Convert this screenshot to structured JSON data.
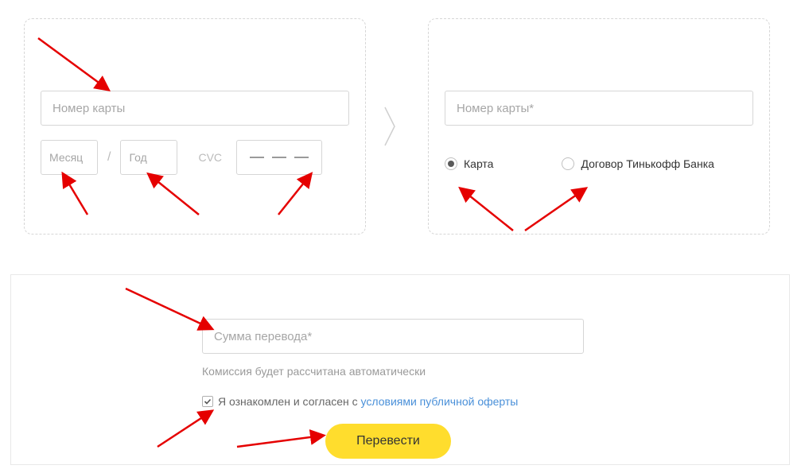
{
  "from_card": {
    "card_number_placeholder": "Номер карты",
    "month_placeholder": "Месяц",
    "year_placeholder": "Год",
    "cvc_label": "CVC"
  },
  "to_card": {
    "card_number_placeholder": "Номер карты*",
    "radio_card_label": "Карта",
    "radio_contract_label": "Договор Тинькофф Банка",
    "radio_selected": "card"
  },
  "transfer": {
    "amount_placeholder": "Сумма перевода*",
    "commission_note": "Комиссия будет рассчитана автоматически",
    "consent_text": "Я ознакомлен и согласен с ",
    "consent_link": "условиями публичной оферты",
    "consent_checked": true,
    "submit_label": "Перевести"
  },
  "colors": {
    "accent": "#ffdd2d",
    "link": "#4a90d9",
    "annotation": "#e50000"
  }
}
